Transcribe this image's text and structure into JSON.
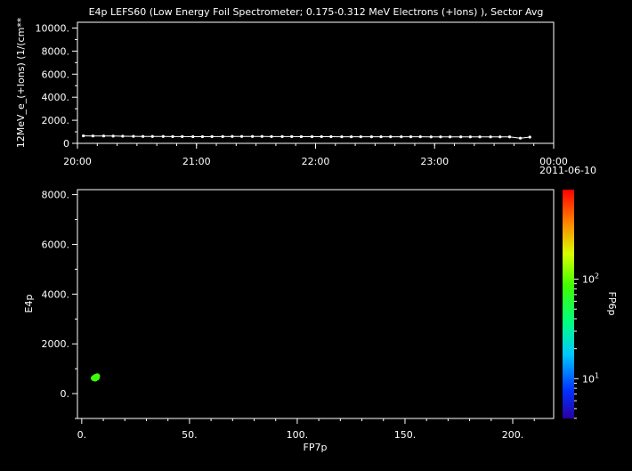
{
  "chart_data": [
    {
      "type": "line",
      "title": "E4p LEFS60 (Low Energy Foil Spectrometer; 0.175-0.312 MeV Electrons (+Ions) ), Sector Avg",
      "ylabel": "12MeV_e_(+Ions) (1/(cm**",
      "xlabel": "",
      "x_tick_labels": [
        "20:00",
        "21:00",
        "22:00",
        "23:00",
        "00:00"
      ],
      "x_date_label": "2011-06-10",
      "x_range_hours": [
        20,
        24
      ],
      "y_tick_labels": [
        "0",
        "2000.",
        "4000.",
        "6000.",
        "8000.",
        "10000."
      ],
      "ylim": [
        0,
        10500
      ],
      "grid": false,
      "series": [
        {
          "x_hours": [
            20.05,
            20.13,
            20.22,
            20.3,
            20.38,
            20.47,
            20.55,
            20.63,
            20.72,
            20.8,
            20.88,
            20.97,
            21.05,
            21.13,
            21.22,
            21.3,
            21.38,
            21.47,
            21.55,
            21.63,
            21.72,
            21.8,
            21.88,
            21.97,
            22.05,
            22.13,
            22.22,
            22.3,
            22.38,
            22.47,
            22.55,
            22.63,
            22.72,
            22.8,
            22.88,
            22.97,
            23.05,
            23.13,
            23.22,
            23.3,
            23.38,
            23.47,
            23.55,
            23.63,
            23.72,
            23.8
          ],
          "values": [
            650,
            640,
            640,
            630,
            620,
            610,
            600,
            600,
            600,
            590,
            590,
            580,
            580,
            590,
            590,
            600,
            600,
            600,
            600,
            590,
            590,
            590,
            580,
            580,
            580,
            580,
            570,
            570,
            570,
            570,
            570,
            570,
            570,
            570,
            570,
            560,
            560,
            560,
            560,
            560,
            560,
            560,
            560,
            560,
            450,
            540
          ]
        }
      ]
    },
    {
      "type": "scatter",
      "xlabel": "FP7p",
      "ylabel": "E4p",
      "colorbar_label": "FP6p",
      "x_tick_labels": [
        "0.",
        "50.",
        "100.",
        "150.",
        "200."
      ],
      "y_tick_labels": [
        "0.",
        "2000.",
        "4000.",
        "6000.",
        "8000."
      ],
      "colorbar_tick_labels": [
        {
          "base": "10",
          "exp": "1"
        },
        {
          "base": "10",
          "exp": "2"
        }
      ],
      "xlim": [
        -2,
        219
      ],
      "ylim": [
        -1000,
        8200
      ],
      "colorbar_range_log": [
        0.6,
        2.9
      ],
      "colorbar_scale": "log",
      "grid": false,
      "points": [
        {
          "x": 5.5,
          "y": 620,
          "c": 80
        },
        {
          "x": 6.0,
          "y": 650,
          "c": 80
        },
        {
          "x": 6.5,
          "y": 680,
          "c": 80
        },
        {
          "x": 7.0,
          "y": 640,
          "c": 80
        },
        {
          "x": 6.2,
          "y": 600,
          "c": 80
        },
        {
          "x": 7.2,
          "y": 700,
          "c": 80
        }
      ]
    }
  ]
}
